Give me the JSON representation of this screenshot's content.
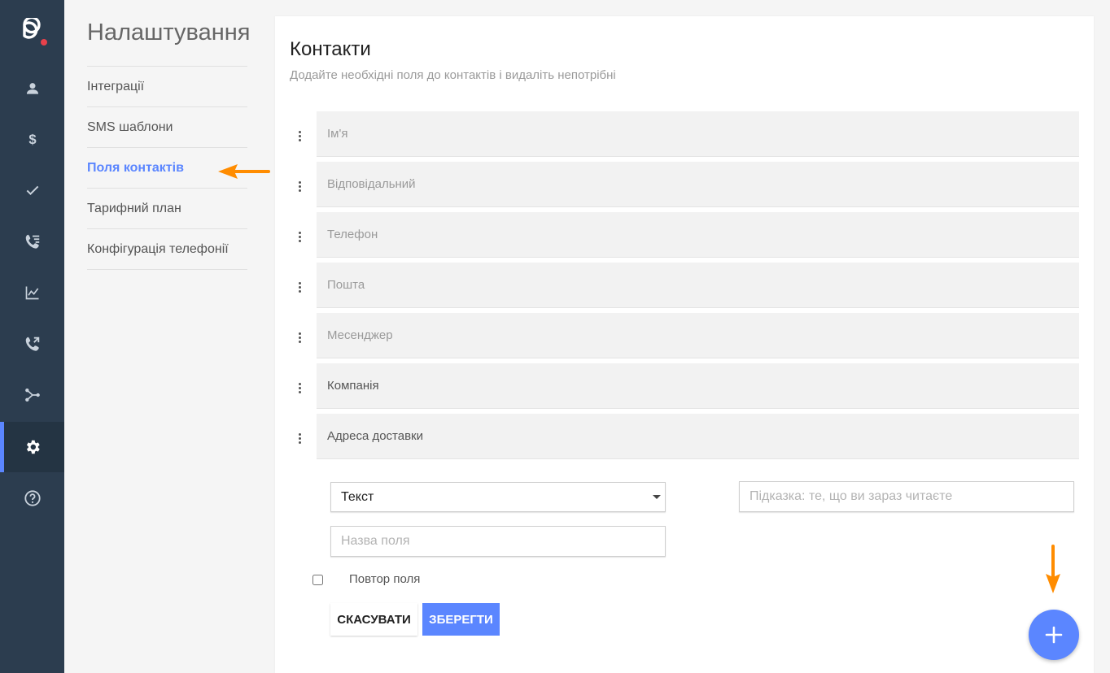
{
  "colors": {
    "accent": "#5b86ff",
    "rail_bg": "#2c3d4f",
    "annotation_arrow": "#ff8c00",
    "logo_dot": "#e8414b"
  },
  "rail": {
    "items": [
      {
        "icon": "person-icon"
      },
      {
        "icon": "dollar-icon"
      },
      {
        "icon": "check-icon"
      },
      {
        "icon": "call-list-icon"
      },
      {
        "icon": "chart-line-icon"
      },
      {
        "icon": "call-transfer-icon"
      },
      {
        "icon": "flow-icon"
      },
      {
        "icon": "gear-icon",
        "active": true
      },
      {
        "icon": "help-icon"
      }
    ]
  },
  "settings_nav": {
    "title": "Налаштування",
    "items": [
      {
        "label": "Інтеграції"
      },
      {
        "label": "SMS шаблони"
      },
      {
        "label": "Поля контактів",
        "active": true
      },
      {
        "label": "Тарифний план"
      },
      {
        "label": "Конфігурація телефонії"
      }
    ]
  },
  "main": {
    "title": "Контакти",
    "subtitle": "Додайте необхідні поля до контактів і видаліть непотрібні",
    "fields": [
      {
        "label": "Ім'я"
      },
      {
        "label": "Відповідальний"
      },
      {
        "label": "Телефон"
      },
      {
        "label": "Пошта"
      },
      {
        "label": "Месенджер"
      },
      {
        "label": "Компанія"
      },
      {
        "label": "Адреса доставки"
      }
    ],
    "form": {
      "type_select_value": "Текст",
      "hint_placeholder": "Підказка: те, що ви зараз читаєте",
      "name_placeholder": "Назва поля",
      "repeat_label": "Повтор поля",
      "cancel_label": "СКАСУВАТИ",
      "save_label": "ЗБЕРЕГТИ"
    },
    "fab_icon": "plus-icon"
  }
}
